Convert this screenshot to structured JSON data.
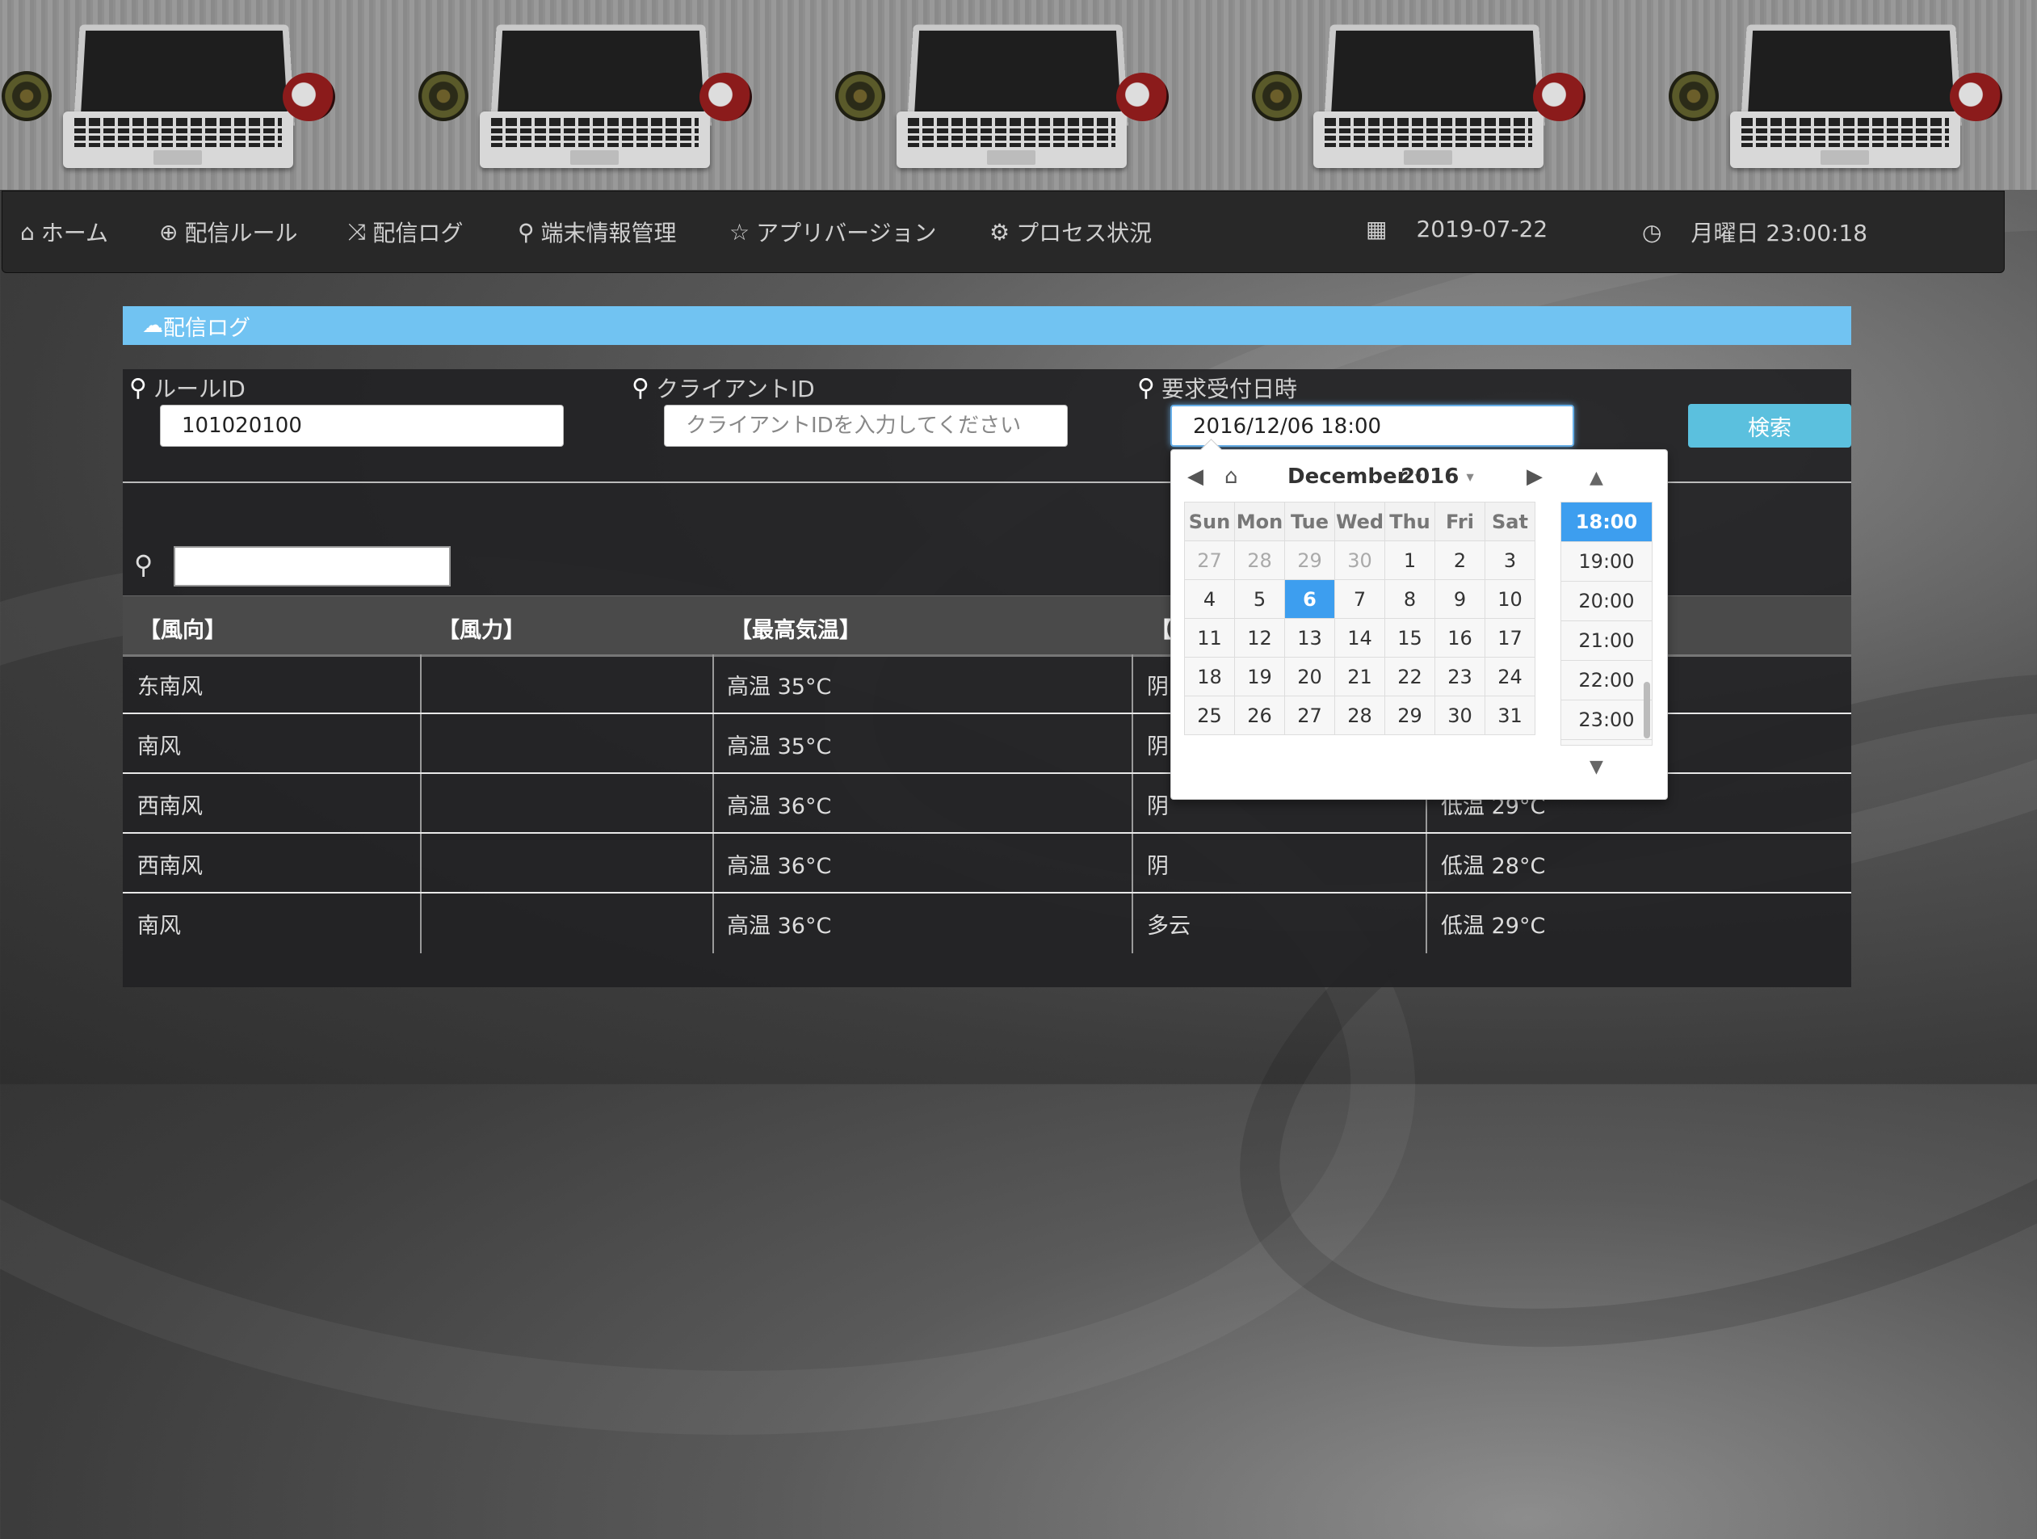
{
  "nav": {
    "items": [
      {
        "label": "ホーム",
        "icon": "home-icon"
      },
      {
        "label": "配信ルール",
        "icon": "zoom-in-icon"
      },
      {
        "label": "配信ログ",
        "icon": "shuffle-icon"
      },
      {
        "label": "端末情報管理",
        "icon": "search-icon"
      },
      {
        "label": "アプリバージョン",
        "icon": "star-icon"
      },
      {
        "label": "プロセス状況",
        "icon": "gear-icon"
      }
    ],
    "date": "2019-07-22",
    "time": "月曜日 23:00:18"
  },
  "panel": {
    "title": "配信ログ",
    "fields": {
      "rule_id": {
        "label": "ルールID",
        "value": "101020100"
      },
      "client_id": {
        "label": "クライアントID",
        "placeholder": "クライアントIDを入力してください"
      },
      "request_time": {
        "label": "要求受付日時",
        "value": "2016/12/06 18:00"
      }
    },
    "search_button": "検索"
  },
  "table": {
    "headers": [
      "【風向】",
      "【風力】",
      "【最高気温】",
      "【",
      ""
    ],
    "rows": [
      [
        "东南风",
        "",
        "高温 35°C",
        "阴",
        ""
      ],
      [
        "南风",
        "",
        "高温 35°C",
        "阴",
        ""
      ],
      [
        "西南风",
        "",
        "高温 36°C",
        "阴",
        "低温 29°C"
      ],
      [
        "西南风",
        "",
        "高温 36°C",
        "阴",
        "低温 28°C"
      ],
      [
        "南风",
        "",
        "高温 36°C",
        "多云",
        "低温 29°C"
      ]
    ]
  },
  "datepicker": {
    "month": "December",
    "year": "2016",
    "weekdays": [
      "Sun",
      "Mon",
      "Tue",
      "Wed",
      "Thu",
      "Fri",
      "Sat"
    ],
    "weeks": [
      [
        "27",
        "28",
        "29",
        "30",
        "1",
        "2",
        "3"
      ],
      [
        "4",
        "5",
        "6",
        "7",
        "8",
        "9",
        "10"
      ],
      [
        "11",
        "12",
        "13",
        "14",
        "15",
        "16",
        "17"
      ],
      [
        "18",
        "19",
        "20",
        "21",
        "22",
        "23",
        "24"
      ],
      [
        "25",
        "26",
        "27",
        "28",
        "29",
        "30",
        "31"
      ]
    ],
    "selected_day": "6",
    "times": [
      "18:00",
      "19:00",
      "20:00",
      "21:00",
      "22:00",
      "23:00"
    ],
    "selected_time": "18:00"
  }
}
